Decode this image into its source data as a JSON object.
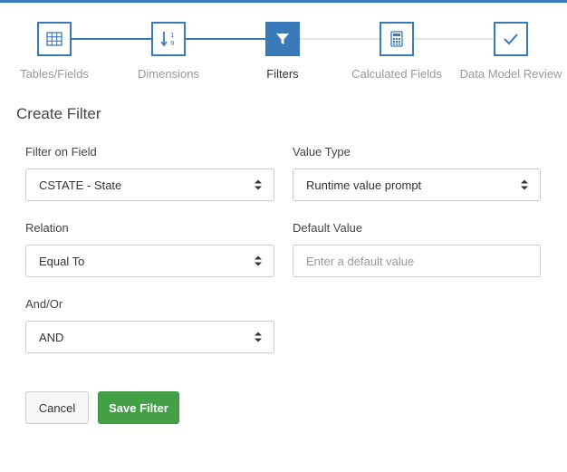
{
  "steps": [
    {
      "label": "Tables/Fields",
      "icon": "grid-icon",
      "state": "done"
    },
    {
      "label": "Dimensions",
      "icon": "sort-numeric-icon",
      "state": "done"
    },
    {
      "label": "Filters",
      "icon": "filter-icon",
      "state": "active"
    },
    {
      "label": "Calculated Fields",
      "icon": "calculator-icon",
      "state": "todo"
    },
    {
      "label": "Data Model Review",
      "icon": "checkmark-icon",
      "state": "todo"
    }
  ],
  "form": {
    "title": "Create Filter",
    "filter_on_field": {
      "label": "Filter on Field",
      "value": "CSTATE - State"
    },
    "value_type": {
      "label": "Value Type",
      "value": "Runtime value prompt"
    },
    "relation": {
      "label": "Relation",
      "value": "Equal To"
    },
    "default_value": {
      "label": "Default Value",
      "value": "",
      "placeholder": "Enter a default value"
    },
    "and_or": {
      "label": "And/Or",
      "value": "AND"
    }
  },
  "buttons": {
    "cancel": "Cancel",
    "save": "Save Filter"
  },
  "colors": {
    "accent": "#3a7ab8",
    "success": "#43a047"
  }
}
